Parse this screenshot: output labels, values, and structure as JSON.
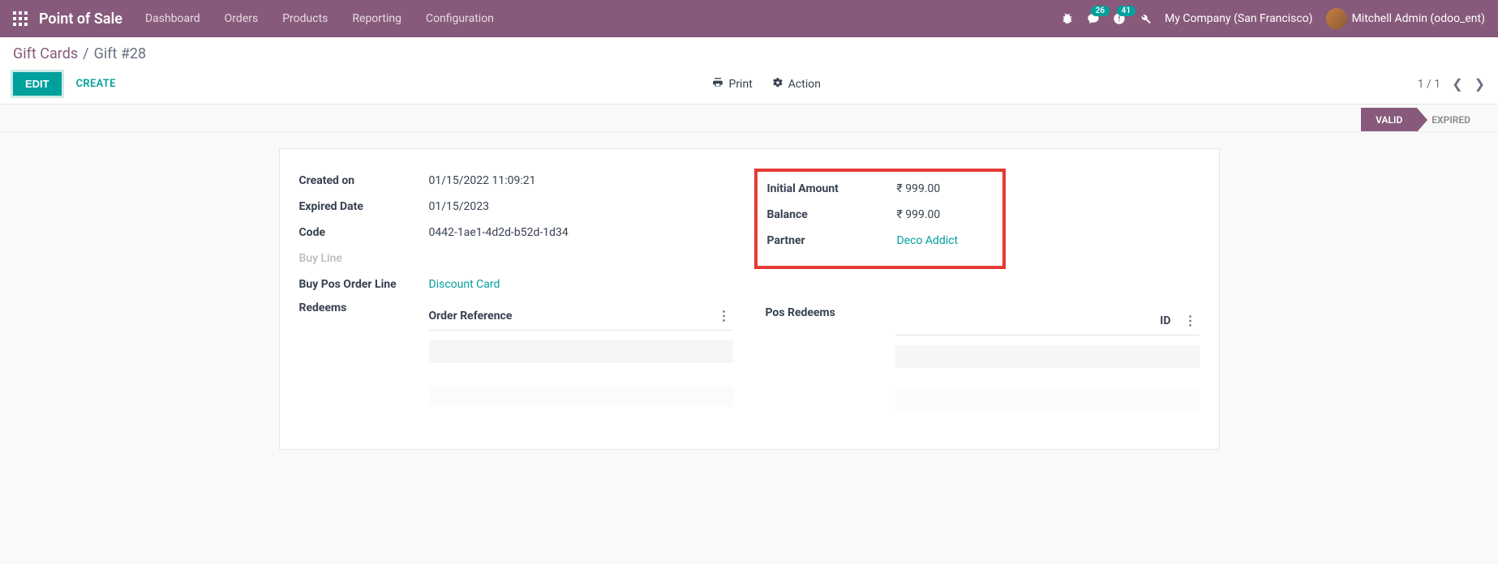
{
  "nav": {
    "brand": "Point of Sale",
    "links": [
      "Dashboard",
      "Orders",
      "Products",
      "Reporting",
      "Configuration"
    ],
    "messages_badge": "26",
    "activities_badge": "41",
    "company": "My Company (San Francisco)",
    "user": "Mitchell Admin (odoo_ent)"
  },
  "breadcrumb": {
    "parent": "Gift Cards",
    "sep": "/",
    "current": "Gift #28"
  },
  "actions": {
    "edit": "EDIT",
    "create": "CREATE",
    "print": "Print",
    "action": "Action"
  },
  "pager": {
    "text": "1 / 1"
  },
  "status": {
    "active": "VALID",
    "inactive": "EXPIRED"
  },
  "fields": {
    "created_on_label": "Created on",
    "created_on": "01/15/2022 11:09:21",
    "expired_label": "Expired Date",
    "expired": "01/15/2023",
    "code_label": "Code",
    "code": "0442-1ae1-4d2d-b52d-1d34",
    "buy_line_label": "Buy Line",
    "buy_pos_line_label": "Buy Pos Order Line",
    "buy_pos_line": "Discount Card",
    "redeems_label": "Redeems",
    "order_ref_header": "Order Reference",
    "initial_amount_label": "Initial Amount",
    "initial_amount": "₹ 999.00",
    "balance_label": "Balance",
    "balance": "₹ 999.00",
    "partner_label": "Partner",
    "partner": "Deco Addict",
    "pos_redeems_label": "Pos Redeems",
    "id_header": "ID"
  }
}
